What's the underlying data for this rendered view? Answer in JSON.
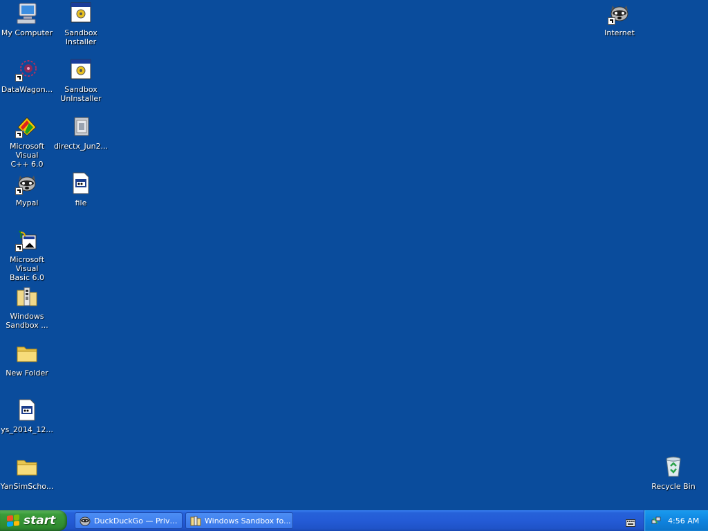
{
  "desktop": {
    "background_color": "#0a4c9c",
    "icons": [
      {
        "id": "my-computer",
        "label": "My Computer",
        "icon": "computer-icon"
      },
      {
        "id": "sandbox-installer",
        "label": "Sandbox\nInstaller",
        "icon": "installer-window-icon"
      },
      {
        "id": "datawagon",
        "label": "DataWagon...",
        "icon": "datawagon-icon"
      },
      {
        "id": "sandbox-uninstaller",
        "label": "Sandbox\nUnInstaller",
        "icon": "installer-window-icon"
      },
      {
        "id": "ms-visual-cpp",
        "label": "Microsoft Visual\nC++ 6.0",
        "icon": "visual-cpp-icon"
      },
      {
        "id": "directx",
        "label": "directx_Jun2...",
        "icon": "setup-package-icon"
      },
      {
        "id": "mypal",
        "label": "Mypal",
        "icon": "raccoon-icon"
      },
      {
        "id": "file",
        "label": "file",
        "icon": "document-icon"
      },
      {
        "id": "ms-visual-basic",
        "label": "Microsoft Visual\nBasic 6.0",
        "icon": "visual-basic-icon"
      },
      {
        "id": "windows-sandbox",
        "label": "Windows\nSandbox ...",
        "icon": "zip-folder-icon"
      },
      {
        "id": "new-folder",
        "label": "New Folder",
        "icon": "folder-icon"
      },
      {
        "id": "ys-file",
        "label": "ys_2014_12...",
        "icon": "document-icon"
      },
      {
        "id": "yansimscho",
        "label": "YanSimScho...",
        "icon": "folder-icon"
      },
      {
        "id": "internet",
        "label": "Internet",
        "icon": "raccoon-icon"
      },
      {
        "id": "recycle-bin",
        "label": "Recycle Bin",
        "icon": "recycle-bin-icon"
      }
    ]
  },
  "taskbar": {
    "start_label": "start",
    "tasks": [
      {
        "label": "DuckDuckGo — Privac...",
        "icon": "raccoon-icon"
      },
      {
        "label": "Windows Sandbox fo...",
        "icon": "zip-folder-icon"
      }
    ],
    "keyboard_icon": "keyboard-icon",
    "tray": {
      "network_icon": "network-icon",
      "clock": "4:56 AM"
    }
  },
  "colors": {
    "taskbar_blue": "#245bd6",
    "start_green": "#3a9c3a",
    "tray_blue": "#0f84df"
  }
}
